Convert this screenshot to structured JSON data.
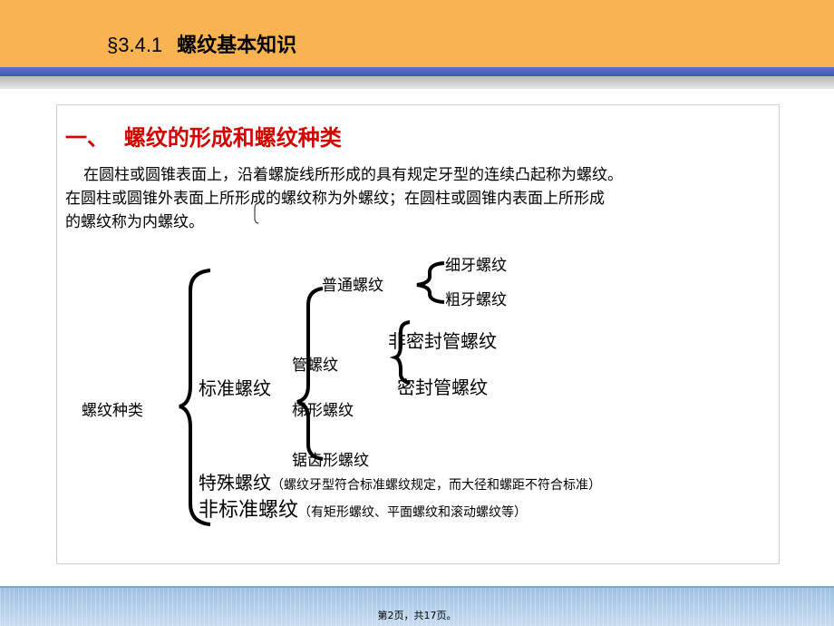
{
  "header": {
    "section": "§3.4.1",
    "title": "螺纹基本知识"
  },
  "heading": "一、  螺纹的形成和螺纹种类",
  "paragraph": {
    "line1": "在圆柱或圆锥表面上，沿着螺旋线所形成的具有规定牙型的连续凸起称为螺纹。",
    "line2": "在圆柱或圆锥外表面上所形成的螺纹称为外螺纹；在圆柱或圆锥内表面上所形成",
    "line3": "的螺纹称为内螺纹。"
  },
  "diagram": {
    "root": "螺纹种类",
    "standard": "标准螺纹",
    "common": "普通螺纹",
    "fine": "细牙螺纹",
    "coarse": "粗牙螺纹",
    "pipe": "管螺纹",
    "non_sealed_pipe": "非密封管螺纹",
    "sealed_pipe": "密封管螺纹",
    "trapezoid": "梯形螺纹",
    "buttress": "锯齿形螺纹",
    "special": "特殊螺纹",
    "special_note": "（螺纹牙型符合标准螺纹规定，而大径和螺距不符合标准）",
    "nonstandard": "非标准螺纹",
    "nonstandard_note": "（有矩形螺纹、平面螺纹和滚动螺纹等）"
  },
  "footer": {
    "page": "第2页，共17页。"
  }
}
